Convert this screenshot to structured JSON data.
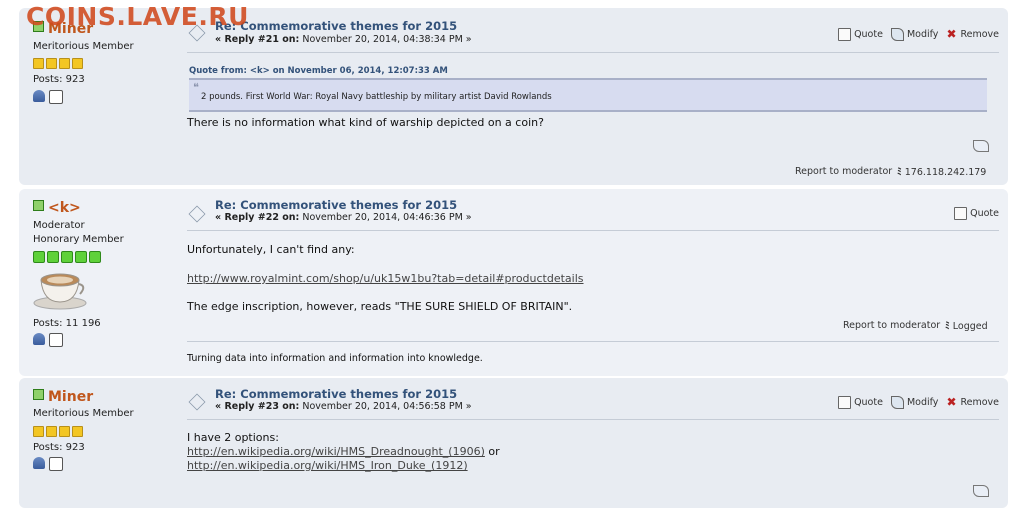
{
  "watermark": "COINS.LAVE.RU",
  "posts": [
    {
      "poster": {
        "name": "Miner",
        "title": "Meritorious Member",
        "posts": "Posts: 923"
      },
      "subject": "Re: Commemorative themes for 2015",
      "reply_label": "« Reply #21 on:",
      "date": "November 20, 2014, 04:38:34 PM »",
      "buttons": {
        "quote": "Quote",
        "modify": "Modify",
        "remove": "Remove"
      },
      "quote_header": "Quote from: <k> on November 06, 2014, 12:07:33 AM",
      "quote_text": "2 pounds.  First World War: Royal Navy battleship by military artist David Rowlands",
      "body": "There is no information what kind of warship depicted on a coin?",
      "report": "Report to moderator",
      "ip": "176.118.242.179"
    },
    {
      "poster": {
        "name": "<k>",
        "title": "Moderator",
        "title2": "Honorary Member",
        "posts": "Posts: 11 196"
      },
      "subject": "Re: Commemorative themes for 2015",
      "reply_label": "« Reply #22 on:",
      "date": "November 20, 2014, 04:46:36 PM »",
      "buttons": {
        "quote": "Quote"
      },
      "body1": "Unfortunately, I can't find any:",
      "link": "http://www.royalmint.com/shop/u/uk15w1bu?tab=detail#productdetails",
      "body2": "The edge inscription, however, reads \"THE SURE SHIELD OF BRITAIN\".",
      "report": "Report to moderator",
      "logged": "Logged",
      "signature": "Turning data into information and information into knowledge."
    },
    {
      "poster": {
        "name": "Miner",
        "title": "Meritorious Member",
        "posts": "Posts: 923"
      },
      "subject": "Re: Commemorative themes for 2015",
      "reply_label": "« Reply #23 on:",
      "date": "November 20, 2014, 04:56:58 PM »",
      "buttons": {
        "quote": "Quote",
        "modify": "Modify",
        "remove": "Remove"
      },
      "body": "I have 2 options:",
      "link1": "http://en.wikipedia.org/wiki/HMS_Dreadnought_(1906)",
      "or": "or",
      "link2": "http://en.wikipedia.org/wiki/HMS_Iron_Duke_(1912)"
    }
  ]
}
